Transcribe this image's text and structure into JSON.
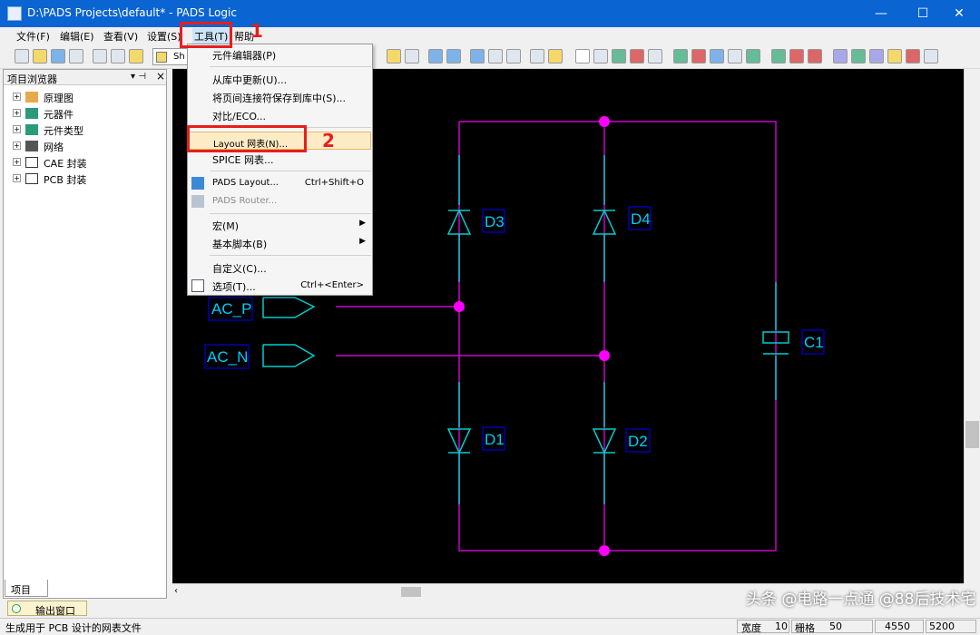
{
  "window": {
    "title": "D:\\PADS Projects\\default* - PADS Logic",
    "minimize_glyph": "—",
    "maximize_glyph": "☐",
    "close_glyph": "✕"
  },
  "menubar": {
    "items": [
      {
        "label": "文件(F)"
      },
      {
        "label": "编辑(E)"
      },
      {
        "label": "查看(V)"
      },
      {
        "label": "设置(S)"
      },
      {
        "label": "工具(T)"
      },
      {
        "label": "帮助"
      }
    ]
  },
  "toolbar": {
    "sheet_combo": "Sh"
  },
  "sidebar": {
    "title": "项目浏览器",
    "pin_glyph": "▾ ⊣",
    "close_glyph": "×",
    "items": [
      {
        "expander": "+",
        "label": "原理图"
      },
      {
        "expander": "+",
        "label": "元器件"
      },
      {
        "expander": "+",
        "label": "元件类型"
      },
      {
        "expander": "+",
        "label": "网络"
      },
      {
        "expander": "+",
        "label": "CAE 封装"
      },
      {
        "expander": "+",
        "label": "PCB 封装"
      }
    ],
    "tab_label": "项目"
  },
  "tools_menu": {
    "items": [
      {
        "label": "元件编辑器(P)",
        "shortcut": "",
        "submenu": false,
        "disabled": false
      },
      {
        "label": "从库中更新(U)...",
        "shortcut": "",
        "submenu": false,
        "disabled": false
      },
      {
        "label": "将页间连接符保存到库中(S)...",
        "shortcut": "",
        "submenu": false,
        "disabled": false
      },
      {
        "label": "对比/ECO...",
        "shortcut": "",
        "submenu": false,
        "disabled": false
      },
      {
        "label": "Layout 网表(N)...",
        "shortcut": "",
        "submenu": false,
        "disabled": false
      },
      {
        "label": "SPICE 网表...",
        "shortcut": "",
        "submenu": false,
        "disabled": false
      },
      {
        "label": "PADS Layout...",
        "shortcut": "Ctrl+Shift+O",
        "submenu": false,
        "disabled": false
      },
      {
        "label": "PADS Router...",
        "shortcut": "",
        "submenu": false,
        "disabled": true
      },
      {
        "label": "宏(M)",
        "shortcut": "",
        "submenu": true,
        "disabled": false
      },
      {
        "label": "基本脚本(B)",
        "shortcut": "",
        "submenu": true,
        "disabled": false
      },
      {
        "label": "自定义(C)...",
        "shortcut": "",
        "submenu": false,
        "disabled": false
      },
      {
        "label": "选项(T)...",
        "shortcut": "Ctrl+<Enter>",
        "submenu": false,
        "disabled": false
      }
    ],
    "submenu_arrow": "▶"
  },
  "annotations": {
    "step1": "1",
    "step2": "2"
  },
  "schematic": {
    "parts": {
      "d1": "D1",
      "d2": "D2",
      "d3": "D3",
      "d4": "D4",
      "c1": "C1"
    },
    "ports": {
      "ac_p": "AC_P",
      "ac_n": "AC_N"
    },
    "colors": {
      "background": "#000000",
      "wire": "#cc00cc",
      "component": "#00cccc",
      "junction": "#ff00ff",
      "label_box": "#0000ff"
    }
  },
  "output": {
    "tab_label": "输出窗口"
  },
  "status": {
    "message": "生成用于 PCB 设计的网表文件",
    "width_label": "宽度",
    "width_value": "10",
    "grid_label": "栅格",
    "grid_value": "50",
    "x_value": "4550",
    "y_value": "5200"
  },
  "watermark": "头条 @电路一点通 @88后技术宅"
}
